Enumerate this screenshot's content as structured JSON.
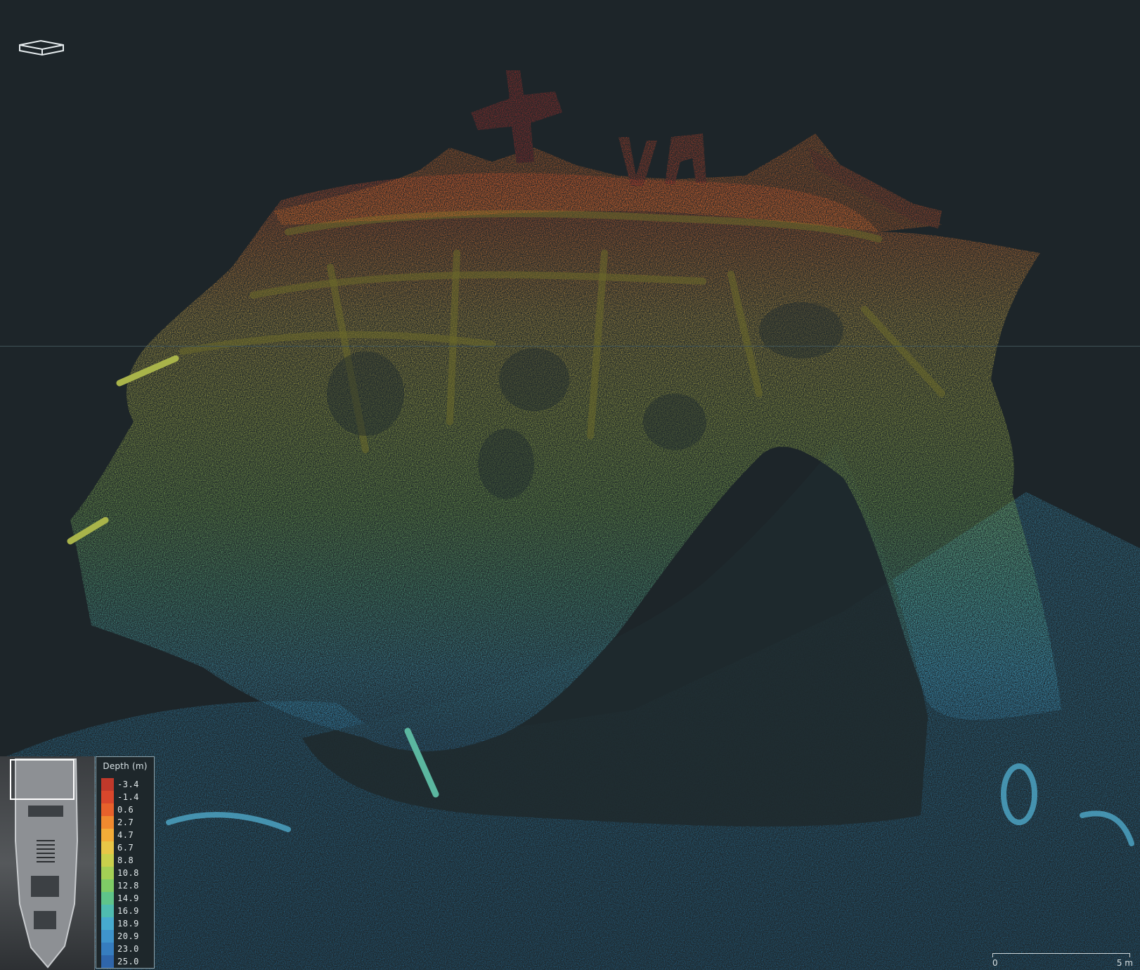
{
  "legend": {
    "title": "Depth (m)",
    "entries": [
      {
        "label": "-3.4",
        "color": "#c0392b"
      },
      {
        "label": "-1.4",
        "color": "#d9472c"
      },
      {
        "label": "0.6",
        "color": "#e8612b"
      },
      {
        "label": "2.7",
        "color": "#f08a2f"
      },
      {
        "label": "4.7",
        "color": "#f3ac38"
      },
      {
        "label": "6.7",
        "color": "#e8c647"
      },
      {
        "label": "8.8",
        "color": "#c9d04c"
      },
      {
        "label": "10.8",
        "color": "#a4cf55"
      },
      {
        "label": "12.8",
        "color": "#7fcb66"
      },
      {
        "label": "14.9",
        "color": "#5fc48a"
      },
      {
        "label": "16.9",
        "color": "#4fbcb0"
      },
      {
        "label": "18.9",
        "color": "#47abcf"
      },
      {
        "label": "20.9",
        "color": "#3f94cc"
      },
      {
        "label": "23.0",
        "color": "#367dbf"
      },
      {
        "label": "25.0",
        "color": "#2f66ab"
      }
    ]
  },
  "scale_bar": {
    "start_label": "0",
    "end_label": "5 m"
  },
  "icons": {
    "orientation": "orientation-box-icon"
  }
}
